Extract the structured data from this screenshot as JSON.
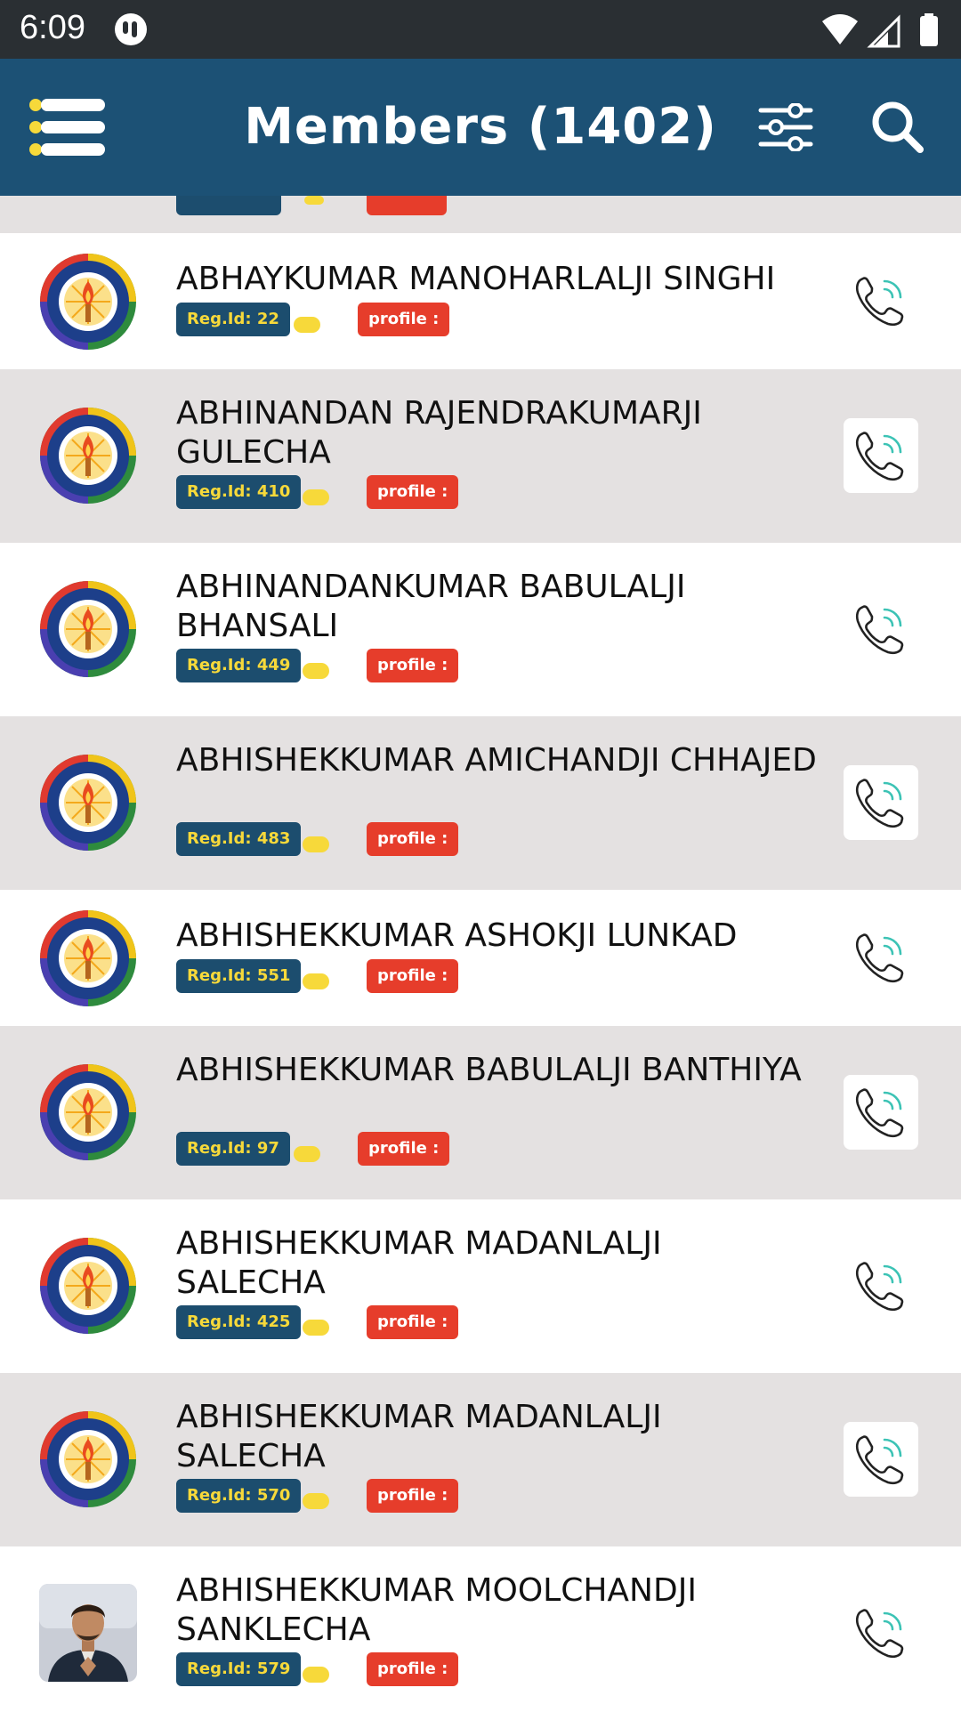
{
  "status_bar": {
    "time": "6:09"
  },
  "app_bar": {
    "title": "Members (1402)"
  },
  "colors": {
    "appbar": "#1c5175",
    "reg_badge": "#1c4d6e",
    "reg_text": "#f7d93a",
    "profile_badge": "#e63d2b",
    "row_alt": "#e4e1e1",
    "call_accent": "#3cc3b5"
  },
  "members": [
    {
      "name": "ABHAYKUMAR MANOHARLALJI SINGHI",
      "reg": "Reg.Id: 22",
      "profile": "profile :"
    },
    {
      "name": "ABHINANDAN RAJENDRAKUMARJI GULECHA",
      "reg": "Reg.Id: 410",
      "profile": "profile :"
    },
    {
      "name": "ABHINANDANKUMAR BABULALJI BHANSALI",
      "reg": "Reg.Id: 449",
      "profile": "profile :"
    },
    {
      "name": "ABHISHEKKUMAR AMICHANDJI CHHAJED",
      "reg": "Reg.Id: 483",
      "profile": "profile :"
    },
    {
      "name": "ABHISHEKKUMAR ASHOKJI LUNKAD",
      "reg": "Reg.Id: 551",
      "profile": "profile :"
    },
    {
      "name": "ABHISHEKKUMAR BABULALJI BANTHIYA",
      "reg": "Reg.Id: 97",
      "profile": "profile :"
    },
    {
      "name": "ABHISHEKKUMAR MADANLALJI SALECHA",
      "reg": "Reg.Id: 425",
      "profile": "profile :"
    },
    {
      "name": "ABHISHEKKUMAR MADANLALJI SALECHA",
      "reg": "Reg.Id: 570",
      "profile": "profile :"
    },
    {
      "name": "ABHISHEKKUMAR MOOLCHANDJI SANKLECHA",
      "reg": "Reg.Id: 579",
      "profile": "profile :"
    }
  ]
}
